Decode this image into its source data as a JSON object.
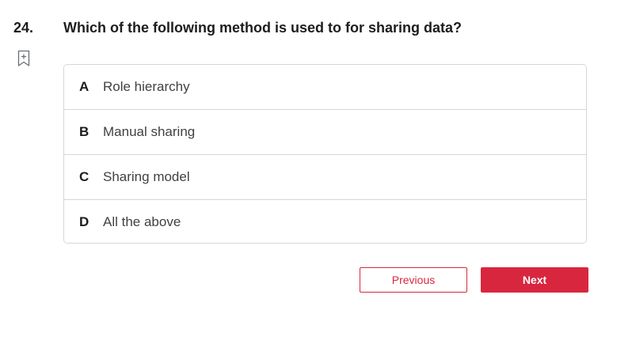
{
  "question": {
    "number": "24.",
    "text": "Which of the following method is used to for sharing data?"
  },
  "bookmark": {
    "icon": "bookmark-add-icon"
  },
  "options": [
    {
      "letter": "A",
      "text": "Role hierarchy"
    },
    {
      "letter": "B",
      "text": "Manual sharing"
    },
    {
      "letter": "C",
      "text": "Sharing model"
    },
    {
      "letter": "D",
      "text": "All the above"
    }
  ],
  "navigation": {
    "previous_label": "Previous",
    "next_label": "Next"
  },
  "colors": {
    "accent": "#d9263f",
    "border": "#d1d7dc",
    "text": "#1c1d1f"
  }
}
